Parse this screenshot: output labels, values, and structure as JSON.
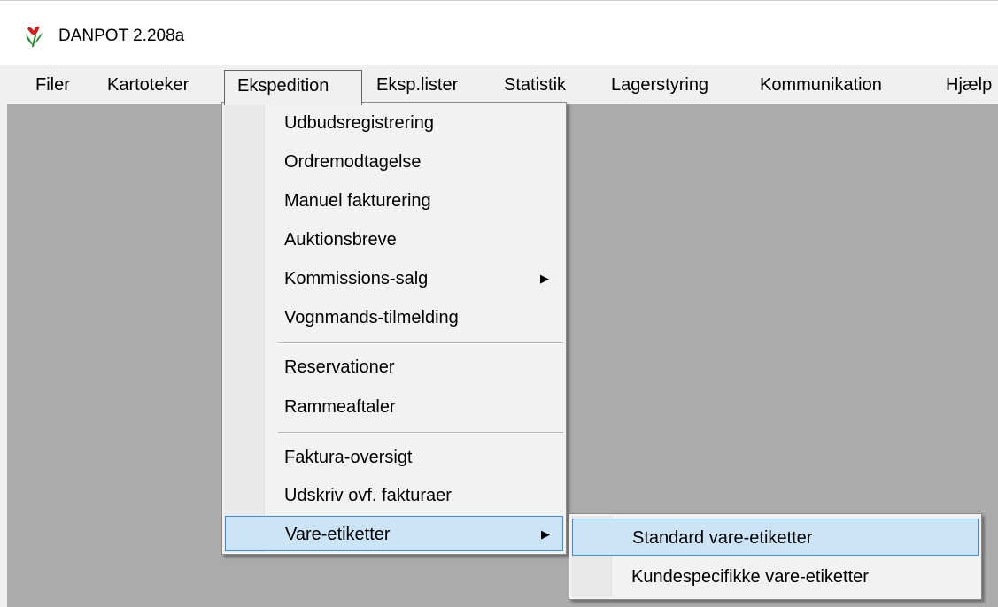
{
  "window": {
    "title": "DANPOT 2.208a",
    "icon": "tulip-icon",
    "icon_colors": {
      "flower": "#d31c1c",
      "leaves": "#1f8a2a"
    }
  },
  "menubar": {
    "items": [
      {
        "label": "Filer"
      },
      {
        "label": "Kartoteker"
      },
      {
        "label": "Ekspedition"
      },
      {
        "label": "Eksp.lister"
      },
      {
        "label": "Statistik"
      },
      {
        "label": "Lagerstyring"
      },
      {
        "label": "Kommunikation"
      },
      {
        "label": "Hjælp"
      }
    ],
    "open_item": "Ekspedition"
  },
  "dropdown": {
    "items": [
      {
        "label": "Udbudsregistrering"
      },
      {
        "label": "Ordremodtagelse"
      },
      {
        "label": "Manuel fakturering"
      },
      {
        "label": "Auktionsbreve"
      },
      {
        "label": "Kommissions-salg",
        "arrow": "▶"
      },
      {
        "label": "Vognmands-tilmelding"
      },
      {
        "label": "Reservationer"
      },
      {
        "label": "Rammeaftaler"
      },
      {
        "label": "Faktura-oversigt"
      },
      {
        "label": "Udskriv ovf. fakturaer"
      },
      {
        "label": "Vare-etiketter",
        "arrow": "▶"
      }
    ],
    "highlighted": "Vare-etiketter"
  },
  "submenu": {
    "items": [
      {
        "label": "Standard vare-etiketter"
      },
      {
        "label": "Kundespecifikke vare-etiketter"
      }
    ],
    "highlighted": "Standard vare-etiketter"
  },
  "colors": {
    "menu_highlight_bg": "#cce4f7",
    "menu_highlight_border": "#3d8ee0",
    "client_bg": "#ababab",
    "menu_bg": "#f0f0f0"
  }
}
